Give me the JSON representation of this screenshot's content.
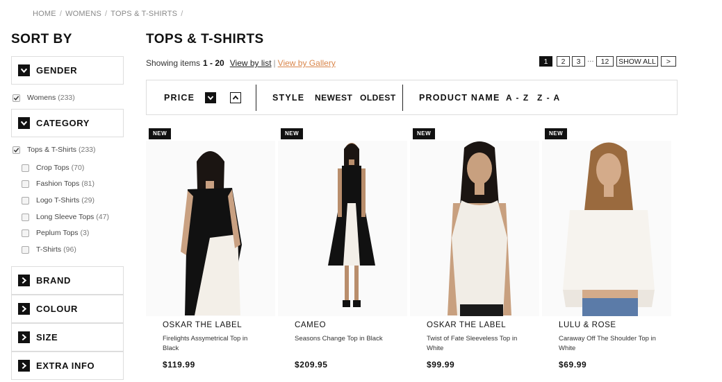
{
  "breadcrumb": [
    "HOME",
    "WOMENS",
    "TOPS & T-SHIRTS"
  ],
  "breadcrumb_sep": "/",
  "sidebar": {
    "title": "SORT BY",
    "facets": {
      "gender": {
        "label": "GENDER",
        "expanded": true
      },
      "category": {
        "label": "CATEGORY",
        "expanded": true
      },
      "brand": {
        "label": "BRAND",
        "expanded": false
      },
      "colour": {
        "label": "COLOUR",
        "expanded": false
      },
      "size": {
        "label": "SIZE",
        "expanded": false
      },
      "extra_info": {
        "label": "EXTRA INFO",
        "expanded": false
      }
    },
    "gender_options": [
      {
        "label": "Womens",
        "count": "(233)",
        "checked": true
      }
    ],
    "category_options": [
      {
        "label": "Tops & T-Shirts",
        "count": "(233)",
        "checked": true
      },
      {
        "label": "Crop Tops",
        "count": "(70)",
        "checked": false
      },
      {
        "label": "Fashion Tops",
        "count": "(81)",
        "checked": false
      },
      {
        "label": "Logo T-Shirts",
        "count": "(29)",
        "checked": false
      },
      {
        "label": "Long Sleeve Tops",
        "count": "(47)",
        "checked": false
      },
      {
        "label": "Peplum Tops",
        "count": "(3)",
        "checked": false
      },
      {
        "label": "T-Shirts",
        "count": "(96)",
        "checked": false
      }
    ]
  },
  "main": {
    "title": "TOPS & T-SHIRTS",
    "showing_prefix": "Showing items",
    "showing_range": "1 - 20",
    "view_list": "View by list",
    "view_sep": "|",
    "view_gallery": "View by Gallery",
    "pager": {
      "pages": [
        "1",
        "2",
        "3"
      ],
      "ellipsis": "...",
      "last": "12",
      "show_all": "SHOW ALL",
      "next": ">",
      "current": "1"
    },
    "sortbar": {
      "price": "PRICE",
      "style": "STYLE",
      "newest": "NEWEST",
      "oldest": "OLDEST",
      "product_name": "PRODUCT NAME",
      "az": "A - Z",
      "za": "Z - A"
    }
  },
  "products": [
    {
      "badge": "NEW",
      "brand": "OSKAR THE LABEL",
      "name": "Firelights Assymetrical Top in Black",
      "price": "$119.99"
    },
    {
      "badge": "NEW",
      "brand": "CAMEO",
      "name": "Seasons Change Top in Black",
      "price": "$209.95"
    },
    {
      "badge": "NEW",
      "brand": "OSKAR THE LABEL",
      "name": "Twist of Fate Sleeveless Top in White",
      "price": "$99.99"
    },
    {
      "badge": "NEW",
      "brand": "LULU & ROSE",
      "name": "Caraway Off The Shoulder Top in White",
      "price": "$69.99"
    }
  ],
  "colors": {
    "accent_link": "#d9854a",
    "dark": "#111111",
    "border": "#dddddd"
  }
}
